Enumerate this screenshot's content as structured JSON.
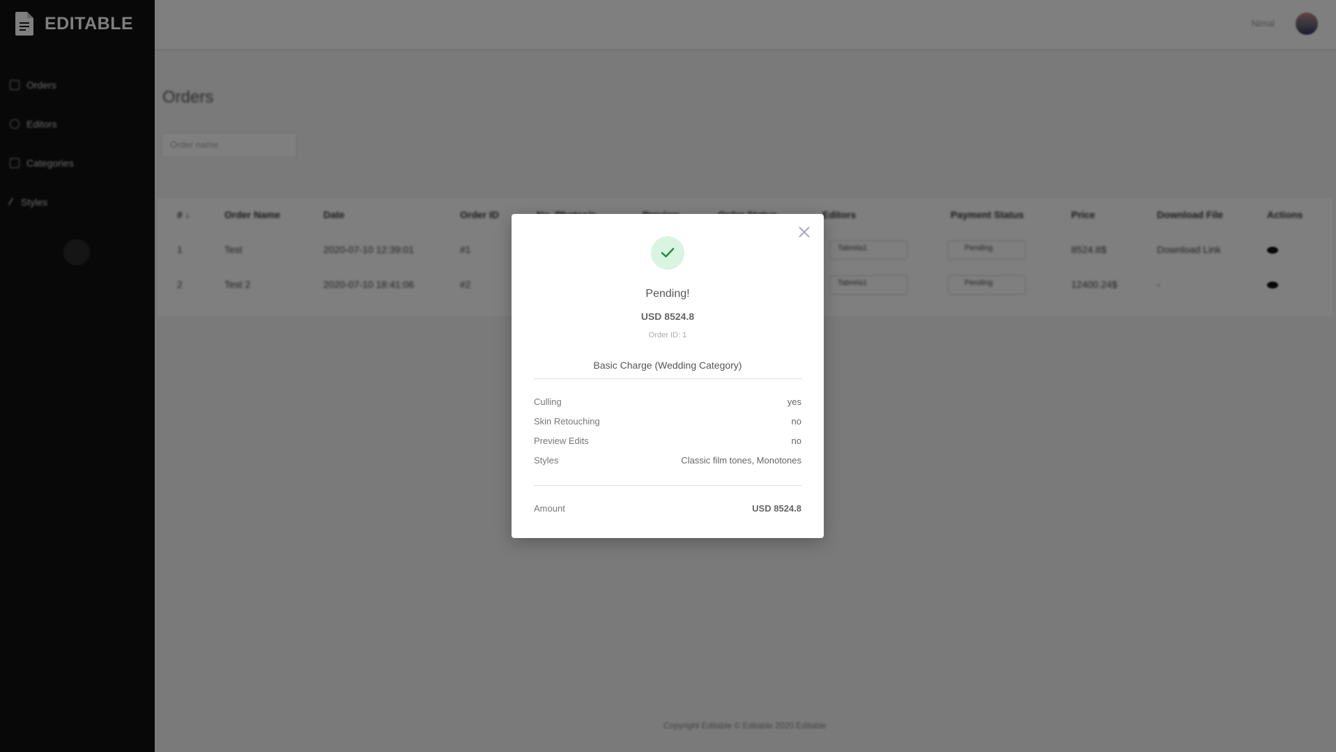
{
  "app": {
    "name": "EDITABLE"
  },
  "sidebar": {
    "items": [
      {
        "label": "Orders",
        "icon": "grid-icon"
      },
      {
        "label": "Editors",
        "icon": "user-icon"
      },
      {
        "label": "Categories",
        "icon": "tag-icon"
      },
      {
        "label": "Styles",
        "icon": "brush-icon"
      }
    ]
  },
  "header": {
    "user_name": "Nimal"
  },
  "page": {
    "title": "Orders",
    "search_placeholder": "Order name"
  },
  "table": {
    "headers": [
      "# ↓",
      "Order Name",
      "Date",
      "Order ID",
      "No. Photos/s",
      "Preview",
      "Order Status",
      "Editors",
      "Payment Status",
      "Price",
      "Download File",
      "Actions"
    ],
    "rows": [
      {
        "num": "1",
        "name": "Test",
        "date": "2020-07-10 12:39:01",
        "order_id": "#1",
        "editor": "Tabrela1",
        "payment": "Pending",
        "price": "8524.8$",
        "download": "Download Link"
      },
      {
        "num": "2",
        "name": "Test 2",
        "date": "2020-07-10 18:41:06",
        "order_id": "#2",
        "editor": "Tabrela1",
        "payment": "Pending",
        "price": "12400.24$",
        "download": "-"
      }
    ]
  },
  "footer": {
    "text": "Copyright Editable © Editable 2020 Editable"
  },
  "modal": {
    "status": "Pending!",
    "total": "USD 8524.8",
    "order_id": "Order ID: 1",
    "charge_title": "Basic Charge (Wedding Category)",
    "details": [
      {
        "label": "Culling",
        "value": "yes"
      },
      {
        "label": "Skin Retouching",
        "value": "no"
      },
      {
        "label": "Preview Edits",
        "value": "no"
      },
      {
        "label": "Styles",
        "value": "Classic film tones, Monotones"
      }
    ],
    "amount_label": "Amount",
    "amount_value": "USD 8524.8",
    "accent_color": "#1e8a44",
    "accent_bg": "#d9f5e2"
  }
}
